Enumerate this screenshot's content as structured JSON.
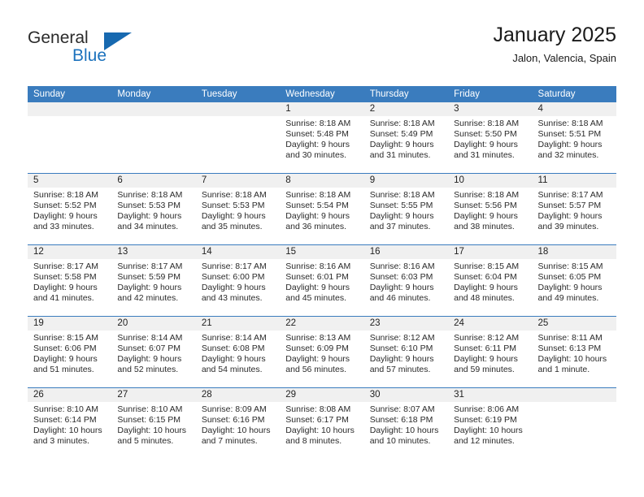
{
  "brand": {
    "name_top": "General",
    "name_bottom": "Blue",
    "accent_color": "#1769b0"
  },
  "header": {
    "title": "January 2025",
    "subtitle": "Jalon, Valencia, Spain"
  },
  "calendar": {
    "header_color": "#3a7cbe",
    "day_band_color": "#f0f0f0",
    "day_names": [
      "Sunday",
      "Monday",
      "Tuesday",
      "Wednesday",
      "Thursday",
      "Friday",
      "Saturday"
    ],
    "weeks": [
      [
        {
          "day": "",
          "lines": []
        },
        {
          "day": "",
          "lines": []
        },
        {
          "day": "",
          "lines": []
        },
        {
          "day": "1",
          "lines": [
            "Sunrise: 8:18 AM",
            "Sunset: 5:48 PM",
            "Daylight: 9 hours",
            "and 30 minutes."
          ]
        },
        {
          "day": "2",
          "lines": [
            "Sunrise: 8:18 AM",
            "Sunset: 5:49 PM",
            "Daylight: 9 hours",
            "and 31 minutes."
          ]
        },
        {
          "day": "3",
          "lines": [
            "Sunrise: 8:18 AM",
            "Sunset: 5:50 PM",
            "Daylight: 9 hours",
            "and 31 minutes."
          ]
        },
        {
          "day": "4",
          "lines": [
            "Sunrise: 8:18 AM",
            "Sunset: 5:51 PM",
            "Daylight: 9 hours",
            "and 32 minutes."
          ]
        }
      ],
      [
        {
          "day": "5",
          "lines": [
            "Sunrise: 8:18 AM",
            "Sunset: 5:52 PM",
            "Daylight: 9 hours",
            "and 33 minutes."
          ]
        },
        {
          "day": "6",
          "lines": [
            "Sunrise: 8:18 AM",
            "Sunset: 5:53 PM",
            "Daylight: 9 hours",
            "and 34 minutes."
          ]
        },
        {
          "day": "7",
          "lines": [
            "Sunrise: 8:18 AM",
            "Sunset: 5:53 PM",
            "Daylight: 9 hours",
            "and 35 minutes."
          ]
        },
        {
          "day": "8",
          "lines": [
            "Sunrise: 8:18 AM",
            "Sunset: 5:54 PM",
            "Daylight: 9 hours",
            "and 36 minutes."
          ]
        },
        {
          "day": "9",
          "lines": [
            "Sunrise: 8:18 AM",
            "Sunset: 5:55 PM",
            "Daylight: 9 hours",
            "and 37 minutes."
          ]
        },
        {
          "day": "10",
          "lines": [
            "Sunrise: 8:18 AM",
            "Sunset: 5:56 PM",
            "Daylight: 9 hours",
            "and 38 minutes."
          ]
        },
        {
          "day": "11",
          "lines": [
            "Sunrise: 8:17 AM",
            "Sunset: 5:57 PM",
            "Daylight: 9 hours",
            "and 39 minutes."
          ]
        }
      ],
      [
        {
          "day": "12",
          "lines": [
            "Sunrise: 8:17 AM",
            "Sunset: 5:58 PM",
            "Daylight: 9 hours",
            "and 41 minutes."
          ]
        },
        {
          "day": "13",
          "lines": [
            "Sunrise: 8:17 AM",
            "Sunset: 5:59 PM",
            "Daylight: 9 hours",
            "and 42 minutes."
          ]
        },
        {
          "day": "14",
          "lines": [
            "Sunrise: 8:17 AM",
            "Sunset: 6:00 PM",
            "Daylight: 9 hours",
            "and 43 minutes."
          ]
        },
        {
          "day": "15",
          "lines": [
            "Sunrise: 8:16 AM",
            "Sunset: 6:01 PM",
            "Daylight: 9 hours",
            "and 45 minutes."
          ]
        },
        {
          "day": "16",
          "lines": [
            "Sunrise: 8:16 AM",
            "Sunset: 6:03 PM",
            "Daylight: 9 hours",
            "and 46 minutes."
          ]
        },
        {
          "day": "17",
          "lines": [
            "Sunrise: 8:15 AM",
            "Sunset: 6:04 PM",
            "Daylight: 9 hours",
            "and 48 minutes."
          ]
        },
        {
          "day": "18",
          "lines": [
            "Sunrise: 8:15 AM",
            "Sunset: 6:05 PM",
            "Daylight: 9 hours",
            "and 49 minutes."
          ]
        }
      ],
      [
        {
          "day": "19",
          "lines": [
            "Sunrise: 8:15 AM",
            "Sunset: 6:06 PM",
            "Daylight: 9 hours",
            "and 51 minutes."
          ]
        },
        {
          "day": "20",
          "lines": [
            "Sunrise: 8:14 AM",
            "Sunset: 6:07 PM",
            "Daylight: 9 hours",
            "and 52 minutes."
          ]
        },
        {
          "day": "21",
          "lines": [
            "Sunrise: 8:14 AM",
            "Sunset: 6:08 PM",
            "Daylight: 9 hours",
            "and 54 minutes."
          ]
        },
        {
          "day": "22",
          "lines": [
            "Sunrise: 8:13 AM",
            "Sunset: 6:09 PM",
            "Daylight: 9 hours",
            "and 56 minutes."
          ]
        },
        {
          "day": "23",
          "lines": [
            "Sunrise: 8:12 AM",
            "Sunset: 6:10 PM",
            "Daylight: 9 hours",
            "and 57 minutes."
          ]
        },
        {
          "day": "24",
          "lines": [
            "Sunrise: 8:12 AM",
            "Sunset: 6:11 PM",
            "Daylight: 9 hours",
            "and 59 minutes."
          ]
        },
        {
          "day": "25",
          "lines": [
            "Sunrise: 8:11 AM",
            "Sunset: 6:13 PM",
            "Daylight: 10 hours",
            "and 1 minute."
          ]
        }
      ],
      [
        {
          "day": "26",
          "lines": [
            "Sunrise: 8:10 AM",
            "Sunset: 6:14 PM",
            "Daylight: 10 hours",
            "and 3 minutes."
          ]
        },
        {
          "day": "27",
          "lines": [
            "Sunrise: 8:10 AM",
            "Sunset: 6:15 PM",
            "Daylight: 10 hours",
            "and 5 minutes."
          ]
        },
        {
          "day": "28",
          "lines": [
            "Sunrise: 8:09 AM",
            "Sunset: 6:16 PM",
            "Daylight: 10 hours",
            "and 7 minutes."
          ]
        },
        {
          "day": "29",
          "lines": [
            "Sunrise: 8:08 AM",
            "Sunset: 6:17 PM",
            "Daylight: 10 hours",
            "and 8 minutes."
          ]
        },
        {
          "day": "30",
          "lines": [
            "Sunrise: 8:07 AM",
            "Sunset: 6:18 PM",
            "Daylight: 10 hours",
            "and 10 minutes."
          ]
        },
        {
          "day": "31",
          "lines": [
            "Sunrise: 8:06 AM",
            "Sunset: 6:19 PM",
            "Daylight: 10 hours",
            "and 12 minutes."
          ]
        },
        {
          "day": "",
          "lines": []
        }
      ]
    ]
  }
}
